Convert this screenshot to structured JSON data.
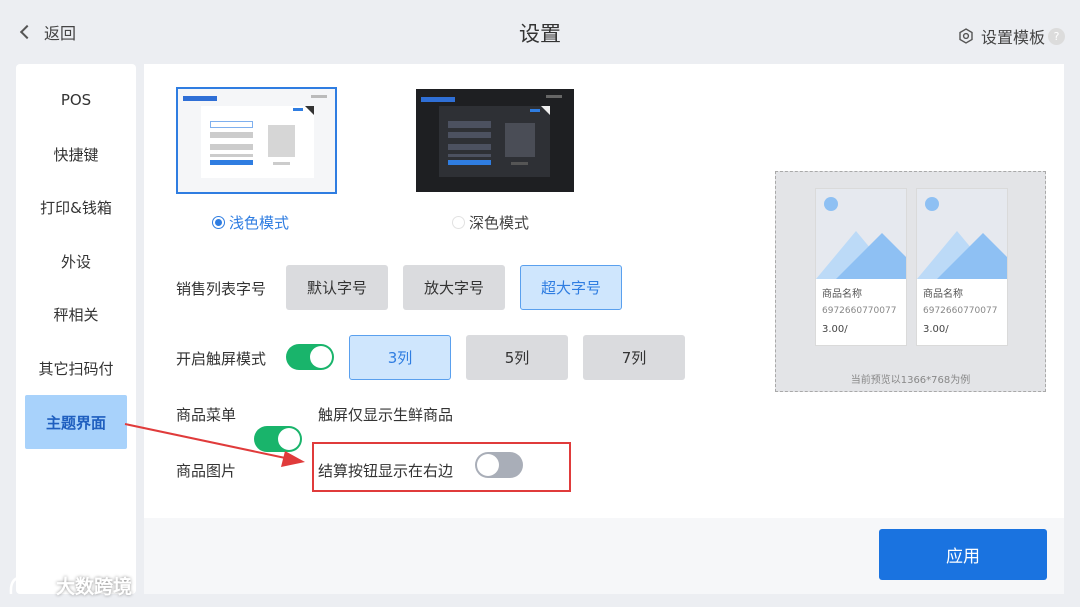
{
  "header": {
    "back_label": "返回",
    "title": "设置",
    "template_label": "设置模板",
    "help": "?"
  },
  "sidebar": {
    "items": [
      {
        "label": "POS",
        "active": false
      },
      {
        "label": "快捷键",
        "active": false
      },
      {
        "label": "打印&钱箱",
        "active": false
      },
      {
        "label": "外设",
        "active": false
      },
      {
        "label": "秤相关",
        "active": false
      },
      {
        "label": "其它扫码付",
        "active": false
      },
      {
        "label": "主题界面",
        "active": true
      }
    ]
  },
  "theme": {
    "light_label": "浅色模式",
    "dark_label": "深色模式",
    "selected": "light"
  },
  "font_size": {
    "label": "销售列表字号",
    "options": [
      "默认字号",
      "放大字号",
      "超大字号"
    ],
    "selected": "超大字号"
  },
  "touch_mode": {
    "label": "开启触屏模式",
    "enabled": true,
    "columns": [
      "3列",
      "5列",
      "7列"
    ],
    "selected": "3列"
  },
  "product_menu": {
    "label": "商品菜单",
    "enabled": true
  },
  "touch_fresh_only": {
    "label": "触屏仅显示生鲜商品",
    "enabled": false
  },
  "product_image": {
    "label": "商品图片",
    "enabled": true
  },
  "checkout_right": {
    "label": "结算按钮显示在右边",
    "enabled": true
  },
  "preview": {
    "cards": [
      {
        "name": "商品名称",
        "code": "6972660770077",
        "price": "3.00/"
      },
      {
        "name": "商品名称",
        "code": "6972660770077",
        "price": "3.00/"
      }
    ],
    "note": "当前预览以1366*768为例"
  },
  "apply_label": "应用",
  "watermark": "大数跨境",
  "colors": {
    "accent": "#1a73e0",
    "toggle_on": "#19b46b",
    "toggle_off": "#a9aeb8",
    "highlight": "#e03b3b",
    "sidebar_active": "#a8d2fb"
  }
}
